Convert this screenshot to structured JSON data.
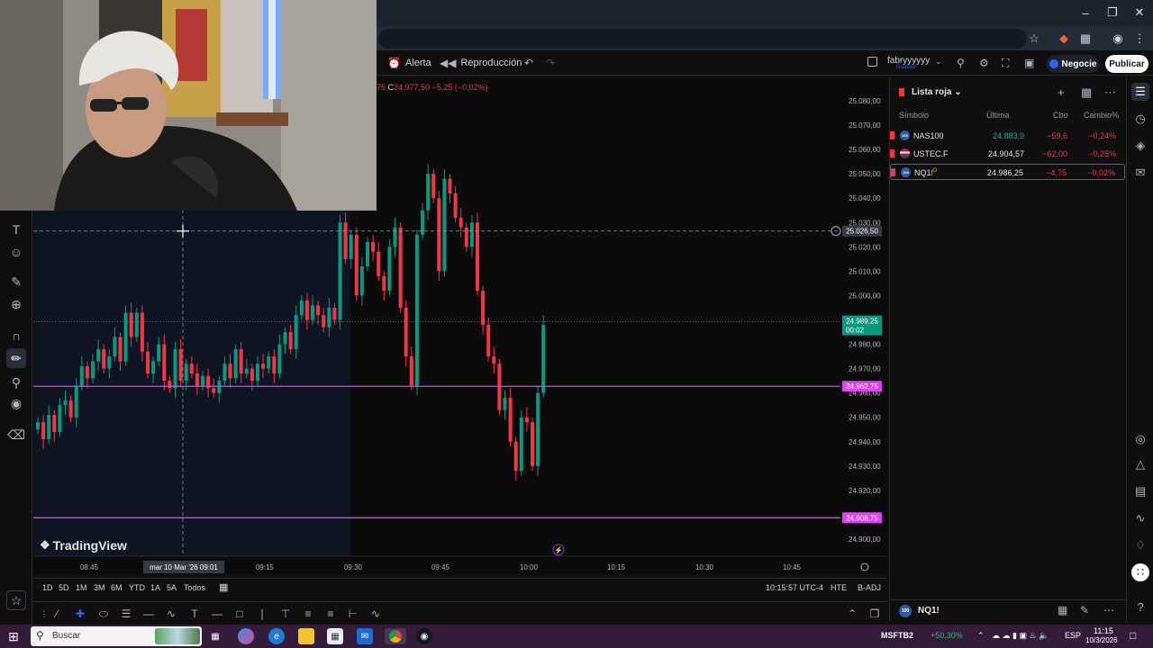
{
  "toolbar": {
    "alert_label": "Alerta",
    "replay_label": "Reproducción",
    "user_name": "fabryyyyyy",
    "user_sub": "Guardar",
    "trade_label": "Negocie",
    "publish_label": "Publicar"
  },
  "legend": {
    "ohlc_prefix": "75",
    "close_label": "C",
    "close_value": "24.977,50",
    "change": "−5,25 (−0,02%)"
  },
  "chart_data": {
    "type": "candlestick",
    "title": "",
    "ylim": [
      24895,
      25085
    ],
    "price_ticks": [
      "25.080,00",
      "25.070,00",
      "25.060,00",
      "25.050,00",
      "25.040,00",
      "25.030,00",
      "25.020,00",
      "25.010,00",
      "25.000,00",
      "24.990,00",
      "24.980,00",
      "24.970,00",
      "24.960,00",
      "24.950,00",
      "24.940,00",
      "24.930,00",
      "24.920,00",
      "24.910,00",
      "24.900,00"
    ],
    "time_ticks": [
      "08:45",
      "09:15",
      "09:30",
      "09:45",
      "10:00",
      "10:15",
      "10:30",
      "10:45"
    ],
    "crosshair_time_label": "mar 10 Mar '26   09:01",
    "crosshair_price": 25026.5,
    "crosshair_price_label": "25.026,50",
    "last_price": 24989.25,
    "last_price_label": "24.989,25",
    "countdown": "00:02",
    "levels": [
      {
        "price": 24962.75,
        "label": "24.962,75",
        "color": "#e040fb"
      },
      {
        "price": 24908.75,
        "label": "24.908,75",
        "color": "#e040fb"
      }
    ],
    "up_color": "#089981",
    "down_color": "#f23645"
  },
  "brand": {
    "name": "TradingView"
  },
  "timeframes": [
    "1D",
    "5D",
    "1M",
    "3M",
    "6M",
    "YTD",
    "1A",
    "5A",
    "Todos"
  ],
  "status": {
    "clock": "10:15:57 UTC-4",
    "session": "HTE",
    "adj": "B-ADJ"
  },
  "watchlist": {
    "title": "Lista roja",
    "col_symbol": "Símbolo",
    "col_last": "Última",
    "col_chg": "Cbo",
    "col_pct": "Cambio%",
    "rows": [
      {
        "symbol": "NAS100",
        "last": "24.883,9",
        "chg": "−59,6",
        "pct": "−0,24%",
        "badge": "100"
      },
      {
        "symbol": "USTEC.F",
        "last": "24.904,57",
        "chg": "−62,00",
        "pct": "−0,25%",
        "badge": ""
      },
      {
        "symbol": "NQ1!",
        "last": "24.986,25",
        "chg": "−4,75",
        "pct": "−0,02%",
        "badge": "100",
        "sup": "D"
      }
    ],
    "bottom_symbol": "NQ1!"
  },
  "taskbar": {
    "search_placeholder": "Buscar",
    "ticker": "MSFTB2",
    "ticker_change": "+50,30%",
    "lang": "ESP",
    "time": "11:15",
    "date": "10/3/2026"
  }
}
